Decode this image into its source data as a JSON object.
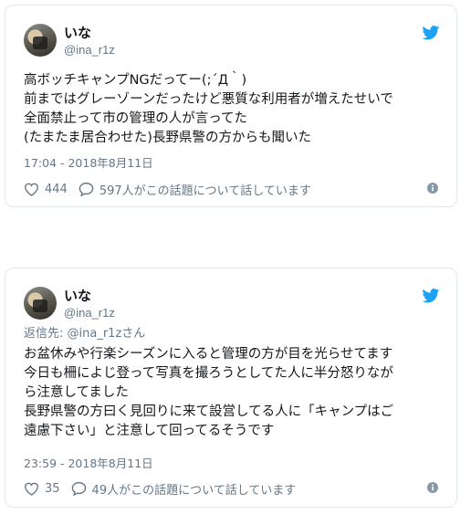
{
  "colors": {
    "twitter_blue": "#1da1f2",
    "muted": "#657786",
    "text": "#14171a",
    "border": "#e1e8ed"
  },
  "tweets": [
    {
      "name": "いな",
      "handle": "@ina_r1z",
      "reply_to": "",
      "text": "高ボッチキャンプNGだってー(;´Д｀)\n前まではグレーゾーンだったけど悪質な利用者が増えたせいで\n全面禁止って市の管理の人が言ってた\n(たまたま居合わせた)長野県警の方からも聞いた",
      "timestamp": "17:04 - 2018年8月11日",
      "likes": "444",
      "talking": "597人がこの話題について話しています",
      "icons": {
        "like": "heart-icon",
        "reply": "speech-bubble-icon",
        "info": "info-icon",
        "brand": "twitter-bird-icon"
      }
    },
    {
      "name": "いな",
      "handle": "@ina_r1z",
      "reply_to": "返信先: @ina_r1zさん",
      "text": "お盆休みや行楽シーズンに入ると管理の方が目を光らせてます\n今日も柵によじ登って写真を撮ろうとしてた人に半分怒りなが\nら注意してました\n長野県警の方曰く見回りに来て設営してる人に「キャンプはご\n遠慮下さい」と注意して回ってるそうです",
      "timestamp": "23:59 - 2018年8月11日",
      "likes": "35",
      "talking": "49人がこの話題について話しています",
      "icons": {
        "like": "heart-icon",
        "reply": "speech-bubble-icon",
        "info": "info-icon",
        "brand": "twitter-bird-icon"
      }
    }
  ]
}
